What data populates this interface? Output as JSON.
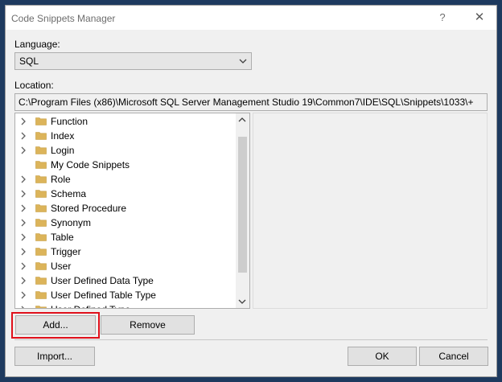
{
  "window": {
    "title": "Code Snippets Manager",
    "help_label": "?",
    "close_label": "✕"
  },
  "language": {
    "label": "Language:",
    "value": "SQL"
  },
  "location": {
    "label": "Location:",
    "value": "C:\\Program Files (x86)\\Microsoft SQL Server Management Studio 19\\Common7\\IDE\\SQL\\Snippets\\1033\\+"
  },
  "tree": {
    "items": [
      {
        "label": "Function",
        "expandable": true
      },
      {
        "label": "Index",
        "expandable": true
      },
      {
        "label": "Login",
        "expandable": true
      },
      {
        "label": "My Code Snippets",
        "expandable": false
      },
      {
        "label": "Role",
        "expandable": true
      },
      {
        "label": "Schema",
        "expandable": true
      },
      {
        "label": "Stored Procedure",
        "expandable": true
      },
      {
        "label": "Synonym",
        "expandable": true
      },
      {
        "label": "Table",
        "expandable": true
      },
      {
        "label": "Trigger",
        "expandable": true
      },
      {
        "label": "User",
        "expandable": true
      },
      {
        "label": "User Defined Data Type",
        "expandable": true
      },
      {
        "label": "User Defined Table Type",
        "expandable": true
      },
      {
        "label": "User Defined Type",
        "expandable": true
      }
    ]
  },
  "buttons": {
    "add": "Add...",
    "remove": "Remove",
    "import": "Import...",
    "ok": "OK",
    "cancel": "Cancel"
  },
  "colors": {
    "folder": "#dcb45a",
    "highlight": "#e0101b",
    "chevron": "#606060"
  }
}
